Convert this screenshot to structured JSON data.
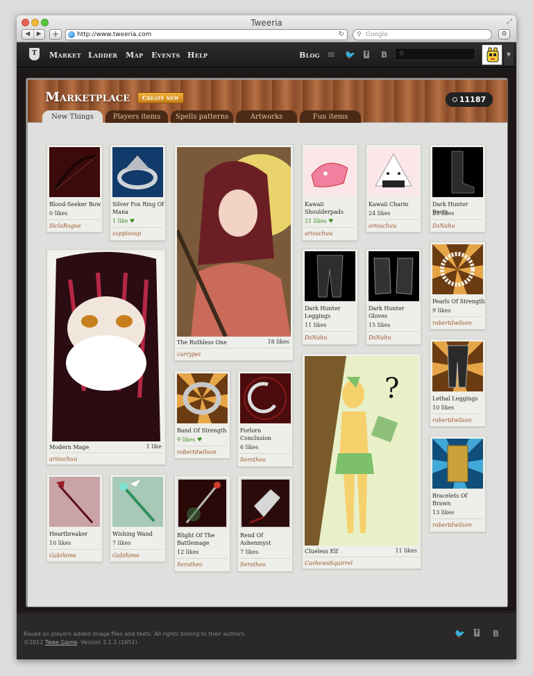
{
  "browser": {
    "window_title": "Tweeria",
    "url": "http://www.tweeria.com",
    "search_placeholder": "Google"
  },
  "nav": {
    "logo_letter": "T",
    "links": [
      "Market",
      "Ladder",
      "Map",
      "Events",
      "Help"
    ],
    "blog": "Blog",
    "social_letters": [
      "B"
    ]
  },
  "header": {
    "title": "Marketplace",
    "create_button": "Create new",
    "balance": "11187"
  },
  "tabs": [
    "New Things",
    "Players items",
    "Spells patterns",
    "Artworks",
    "Fun items"
  ],
  "items": [
    {
      "name": "Blood-Seeker Bow",
      "likes": "0 likes",
      "author": "SiclaRogue",
      "liked": false
    },
    {
      "name": "Silver Fox Ring Of Mana",
      "likes": "1 like",
      "author": "suppisoup",
      "liked": true
    },
    {
      "name": "The Ruthless One",
      "likes": "18 likes",
      "author": "currypei",
      "liked": false
    },
    {
      "name": "Kawaii Shoulderpads",
      "likes": "21 likes",
      "author": "arisuchuu",
      "liked": true
    },
    {
      "name": "Kawaii Charm",
      "likes": "24 likes",
      "author": "arisuchuu",
      "liked": false
    },
    {
      "name": "Dark Hunter Boots",
      "likes": "23 likes",
      "author": "DsNahu",
      "liked": false
    },
    {
      "name": "Modern Mage",
      "likes": "1 like",
      "author": "arisuchuu",
      "liked": false
    },
    {
      "name": "Dark Hunter Leggings",
      "likes": "11 likes",
      "author": "DsNahu",
      "liked": false
    },
    {
      "name": "Dark Hunter Gloves",
      "likes": "15 likes",
      "author": "DsNahu",
      "liked": false
    },
    {
      "name": "Pearls Of Strength",
      "likes": "9 likes",
      "author": "robertdwilson",
      "liked": false
    },
    {
      "name": "Band Of Strength",
      "likes": "9 likes",
      "author": "robertdwilson",
      "liked": true
    },
    {
      "name": "Forlorn Conclusion",
      "likes": "6 likes",
      "author": "Serotheo",
      "liked": false
    },
    {
      "name": "Clueless Elf",
      "likes": "11 likes",
      "author": "CashewsSquirrel",
      "liked": false
    },
    {
      "name": "Lethal Leggings",
      "likes": "10 likes",
      "author": "robertdwilson",
      "liked": false
    },
    {
      "name": "Heartbreaker",
      "likes": "10 likes",
      "author": "Gabihime",
      "liked": false
    },
    {
      "name": "Wishing Wand",
      "likes": "7 likes",
      "author": "Gabihime",
      "liked": false
    },
    {
      "name": "Blight Of The Battlemage",
      "likes": "12 likes",
      "author": "Serotheo",
      "liked": false
    },
    {
      "name": "Rend Of Ashenmyst",
      "likes": "7 likes",
      "author": "Serotheo",
      "liked": false
    },
    {
      "name": "Bracelets Of Brawn",
      "likes": "13 likes",
      "author": "robertdwilson",
      "liked": false
    }
  ],
  "footer": {
    "line1": "Based on players added image files and texts. All rights belong to their authors.",
    "line2_prefix": "©2012 ",
    "line2_link": "Twee Game",
    "line2_suffix": ". Version 2.1.1 (1651)",
    "social_letters": [
      "B"
    ]
  },
  "colors": {
    "accent": "#c67c14",
    "author": "#9c5427",
    "liked": "#3f8f25"
  }
}
